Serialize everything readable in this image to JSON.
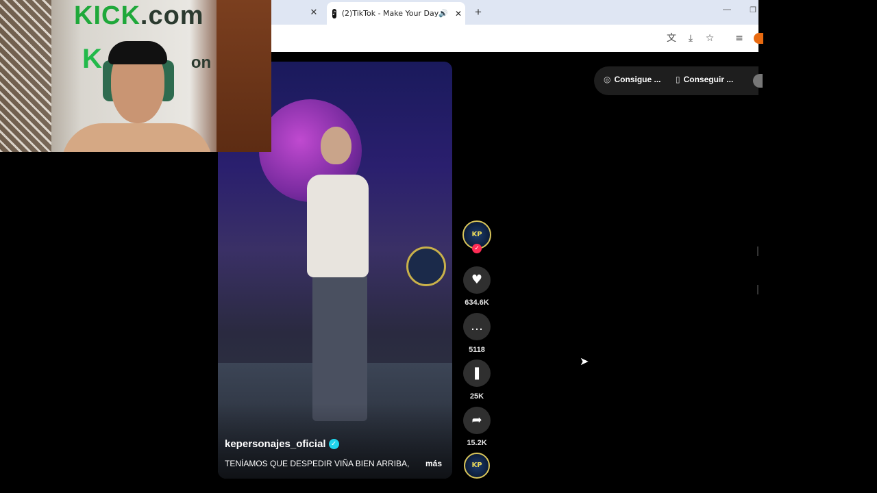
{
  "browser": {
    "active_tab_title": "(2)TikTok - Make Your Day",
    "tiktok_favicon_glyph": "♪",
    "audio_glyph": "🔊",
    "close_glyph": "✕",
    "new_tab_glyph": "+",
    "minimize_glyph": "—",
    "maximize_glyph": "❐",
    "toolbar_icons": [
      "translate-icon",
      "install-app-icon",
      "bookmark-star-icon",
      "media-queue-icon"
    ],
    "toolbar_glyphs": {
      "translate": "文",
      "install": "⤓",
      "star": "☆",
      "queue": "≡"
    },
    "profile_color": "#e86a10"
  },
  "top_pills": {
    "pill1_label": "Consigue ...",
    "pill1_icon": "◎",
    "pill2_label": "Conseguir ...",
    "pill2_icon": "▯"
  },
  "video": {
    "author": "kepersonajes_oficial",
    "verified_glyph": "✓",
    "caption": "TENÍAMOS QUE DESPEDIR  VIÑA BIEN ARRIBA,",
    "more_label": "más"
  },
  "actions": {
    "avatar_text": "KP",
    "follow_glyph": "✓",
    "like_glyph": "♥",
    "like_count": "634.6K",
    "comment_glyph": "…",
    "comment_count": "5118",
    "save_glyph": "❚",
    "save_count": "25K",
    "share_glyph": "➦",
    "share_count": "15.2K"
  },
  "webcam": {
    "sign_line1_green": "KICK",
    "sign_line1_dark": ".com",
    "sign_line2_green": "K",
    "sign_line2_dark": "on"
  },
  "cursor_glyph": "➤",
  "colors": {
    "tiktok_red": "#fe2c55",
    "verified_blue": "#20d5ec",
    "kick_green": "#22b94a"
  }
}
